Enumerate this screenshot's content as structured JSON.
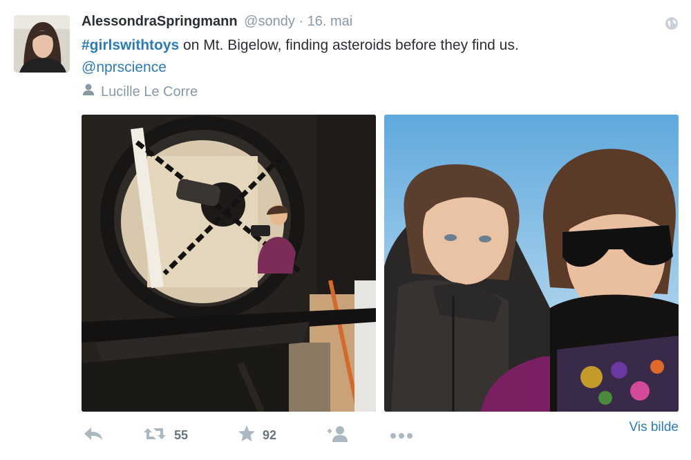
{
  "tweet": {
    "author_name": "AlessondraSpringmann",
    "handle": "@sondy",
    "separator": "·",
    "date": "16. mai",
    "hashtag": "#girlswithtoys",
    "body_text": " on Mt. Bigelow, finding asteroids before they find us.",
    "mention": "@nprscience",
    "photo_credit": "Lucille Le Corre",
    "retweet_count": "55",
    "favorite_count": "92",
    "view_image_label": "Vis bilde"
  },
  "icons": {
    "globe": "globe-icon",
    "person": "person-icon",
    "reply": "reply-icon",
    "retweet": "retweet-icon",
    "favorite": "star-icon",
    "follow": "follow-icon",
    "more": "more-icon"
  },
  "colors": {
    "link": "#2b7bb9",
    "muted": "#8899a6",
    "icon": "#aab8c2",
    "text": "#292f33"
  }
}
